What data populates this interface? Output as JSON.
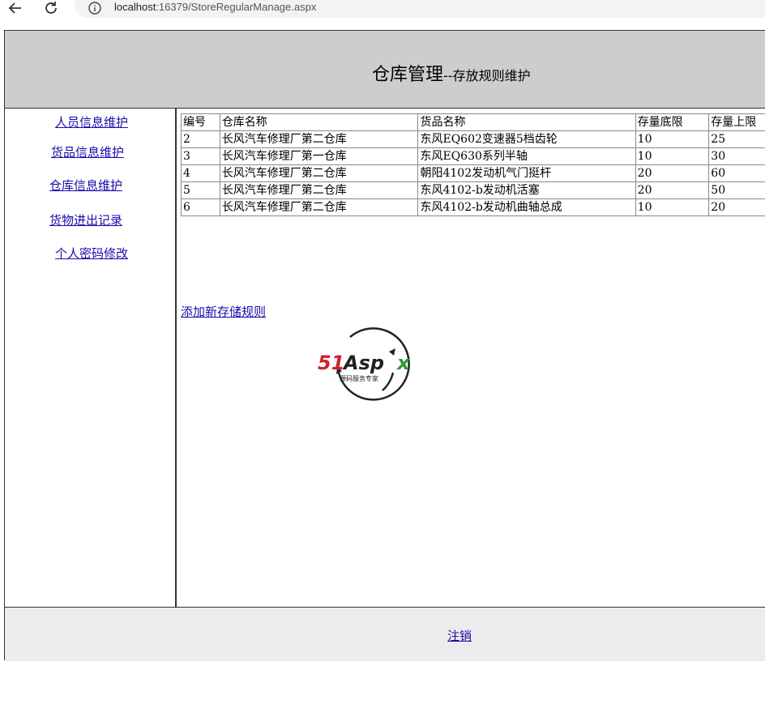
{
  "browser": {
    "url_host": "localhost",
    "url_path": ":16379/StoreRegularManage.aspx"
  },
  "header": {
    "title_main": "仓库管理",
    "title_sub": "--存放规则维护"
  },
  "sidebar": {
    "items": [
      {
        "label": "人员信息维护"
      },
      {
        "label": "货品信息维护"
      },
      {
        "label": "仓库信息维护"
      },
      {
        "label": "货物进出记录"
      },
      {
        "label": "个人密码修改"
      }
    ]
  },
  "table": {
    "headers": [
      "编号",
      "仓库名称",
      "货品名称",
      "存量底限",
      "存量上限"
    ],
    "rows": [
      [
        "2",
        "长风汽车修理厂第二仓库",
        "东风EQ602变速器5档齿轮",
        "10",
        "25"
      ],
      [
        "3",
        "长风汽车修理厂第一仓库",
        "东风EQ630系列半轴",
        "10",
        "30"
      ],
      [
        "4",
        "长风汽车修理厂第二仓库",
        "朝阳4102发动机气门挺杆",
        "20",
        "60"
      ],
      [
        "5",
        "长风汽车修理厂第二仓库",
        "东风4102-b发动机活塞",
        "20",
        "50"
      ],
      [
        "6",
        "长风汽车修理厂第二仓库",
        "东风4102-b发动机曲轴总成",
        "10",
        "20"
      ]
    ]
  },
  "content": {
    "add_link": "添加新存储规则",
    "logo_brand": "51Aspx",
    "logo_tagline": "源码服务专家"
  },
  "footer": {
    "logout": "注销"
  },
  "colors": {
    "header_bg": "#cdcdcd",
    "footer_bg": "#ececec",
    "link": "#1a0dab",
    "logo_red": "#d0202a",
    "logo_green": "#2e9b3a"
  }
}
